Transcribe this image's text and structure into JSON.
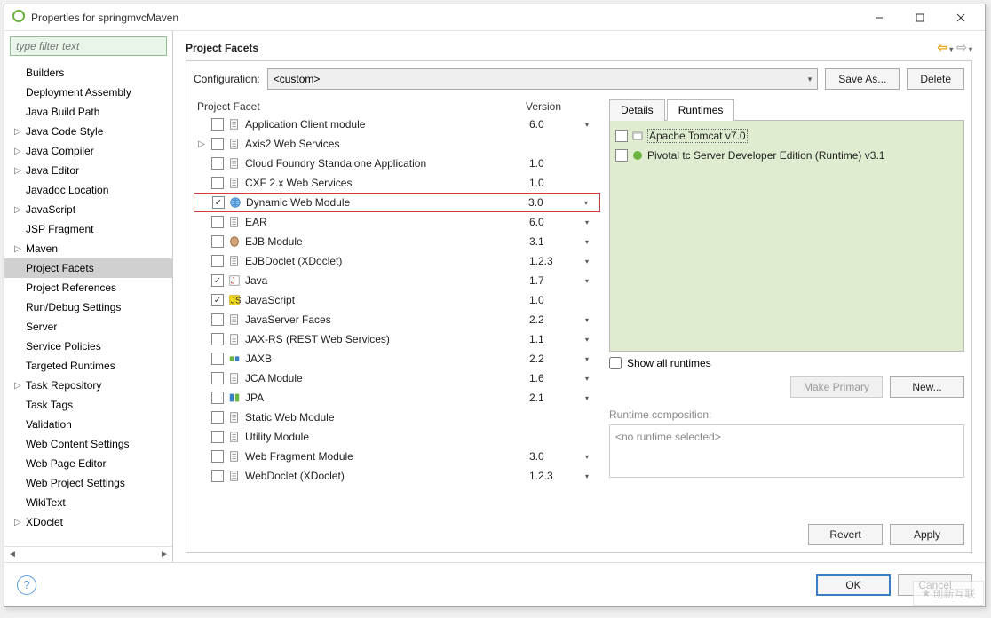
{
  "window": {
    "title": "Properties for springmvcMaven"
  },
  "sidebar": {
    "filter_placeholder": "type filter text",
    "items": [
      {
        "label": "Builders",
        "expandable": false
      },
      {
        "label": "Deployment Assembly",
        "expandable": false
      },
      {
        "label": "Java Build Path",
        "expandable": false
      },
      {
        "label": "Java Code Style",
        "expandable": true
      },
      {
        "label": "Java Compiler",
        "expandable": true
      },
      {
        "label": "Java Editor",
        "expandable": true
      },
      {
        "label": "Javadoc Location",
        "expandable": false
      },
      {
        "label": "JavaScript",
        "expandable": true
      },
      {
        "label": "JSP Fragment",
        "expandable": false
      },
      {
        "label": "Maven",
        "expandable": true
      },
      {
        "label": "Project Facets",
        "expandable": false,
        "selected": true
      },
      {
        "label": "Project References",
        "expandable": false
      },
      {
        "label": "Run/Debug Settings",
        "expandable": false
      },
      {
        "label": "Server",
        "expandable": false
      },
      {
        "label": "Service Policies",
        "expandable": false
      },
      {
        "label": "Targeted Runtimes",
        "expandable": false
      },
      {
        "label": "Task Repository",
        "expandable": true
      },
      {
        "label": "Task Tags",
        "expandable": false
      },
      {
        "label": "Validation",
        "expandable": false
      },
      {
        "label": "Web Content Settings",
        "expandable": false
      },
      {
        "label": "Web Page Editor",
        "expandable": false
      },
      {
        "label": "Web Project Settings",
        "expandable": false
      },
      {
        "label": "WikiText",
        "expandable": false
      },
      {
        "label": "XDoclet",
        "expandable": true
      }
    ]
  },
  "main": {
    "title": "Project Facets",
    "config_label": "Configuration:",
    "config_value": "<custom>",
    "save_as": "Save As...",
    "delete": "Delete",
    "col_facet": "Project Facet",
    "col_version": "Version",
    "facets": [
      {
        "name": "Application Client module",
        "version": "6.0",
        "checked": false,
        "icon": "doc",
        "drop": true
      },
      {
        "name": "Axis2 Web Services",
        "version": "",
        "checked": false,
        "icon": "doc",
        "expandable": true
      },
      {
        "name": "Cloud Foundry Standalone Application",
        "version": "1.0",
        "checked": false,
        "icon": "doc"
      },
      {
        "name": "CXF 2.x Web Services",
        "version": "1.0",
        "checked": false,
        "icon": "doc"
      },
      {
        "name": "Dynamic Web Module",
        "version": "3.0",
        "checked": true,
        "icon": "globe",
        "drop": true,
        "highlight": true
      },
      {
        "name": "EAR",
        "version": "6.0",
        "checked": false,
        "icon": "doc",
        "drop": true
      },
      {
        "name": "EJB Module",
        "version": "3.1",
        "checked": false,
        "icon": "bean",
        "drop": true
      },
      {
        "name": "EJBDoclet (XDoclet)",
        "version": "1.2.3",
        "checked": false,
        "icon": "doc",
        "drop": true
      },
      {
        "name": "Java",
        "version": "1.7",
        "checked": true,
        "icon": "java",
        "drop": true
      },
      {
        "name": "JavaScript",
        "version": "1.0",
        "checked": true,
        "icon": "js"
      },
      {
        "name": "JavaServer Faces",
        "version": "2.2",
        "checked": false,
        "icon": "doc",
        "drop": true
      },
      {
        "name": "JAX-RS (REST Web Services)",
        "version": "1.1",
        "checked": false,
        "icon": "doc",
        "drop": true
      },
      {
        "name": "JAXB",
        "version": "2.2",
        "checked": false,
        "icon": "jaxb",
        "drop": true
      },
      {
        "name": "JCA Module",
        "version": "1.6",
        "checked": false,
        "icon": "doc",
        "drop": true
      },
      {
        "name": "JPA",
        "version": "2.1",
        "checked": false,
        "icon": "jpa",
        "drop": true
      },
      {
        "name": "Static Web Module",
        "version": "",
        "checked": false,
        "icon": "doc"
      },
      {
        "name": "Utility Module",
        "version": "",
        "checked": false,
        "icon": "doc"
      },
      {
        "name": "Web Fragment Module",
        "version": "3.0",
        "checked": false,
        "icon": "doc",
        "drop": true
      },
      {
        "name": "WebDoclet (XDoclet)",
        "version": "1.2.3",
        "checked": false,
        "icon": "doc",
        "drop": true
      }
    ],
    "tabs": {
      "details": "Details",
      "runtimes": "Runtimes"
    },
    "runtimes": [
      {
        "label": "Apache Tomcat v7.0",
        "icon": "server",
        "selected": true
      },
      {
        "label": "Pivotal tc Server Developer Edition (Runtime) v3.1",
        "icon": "pivotal"
      }
    ],
    "show_all": "Show all runtimes",
    "make_primary": "Make Primary",
    "new": "New...",
    "rc_label": "Runtime composition:",
    "rc_empty": "<no runtime selected>",
    "revert": "Revert",
    "apply": "Apply"
  },
  "footer": {
    "ok": "OK",
    "cancel": "Cancel"
  },
  "watermark": "创新互联"
}
